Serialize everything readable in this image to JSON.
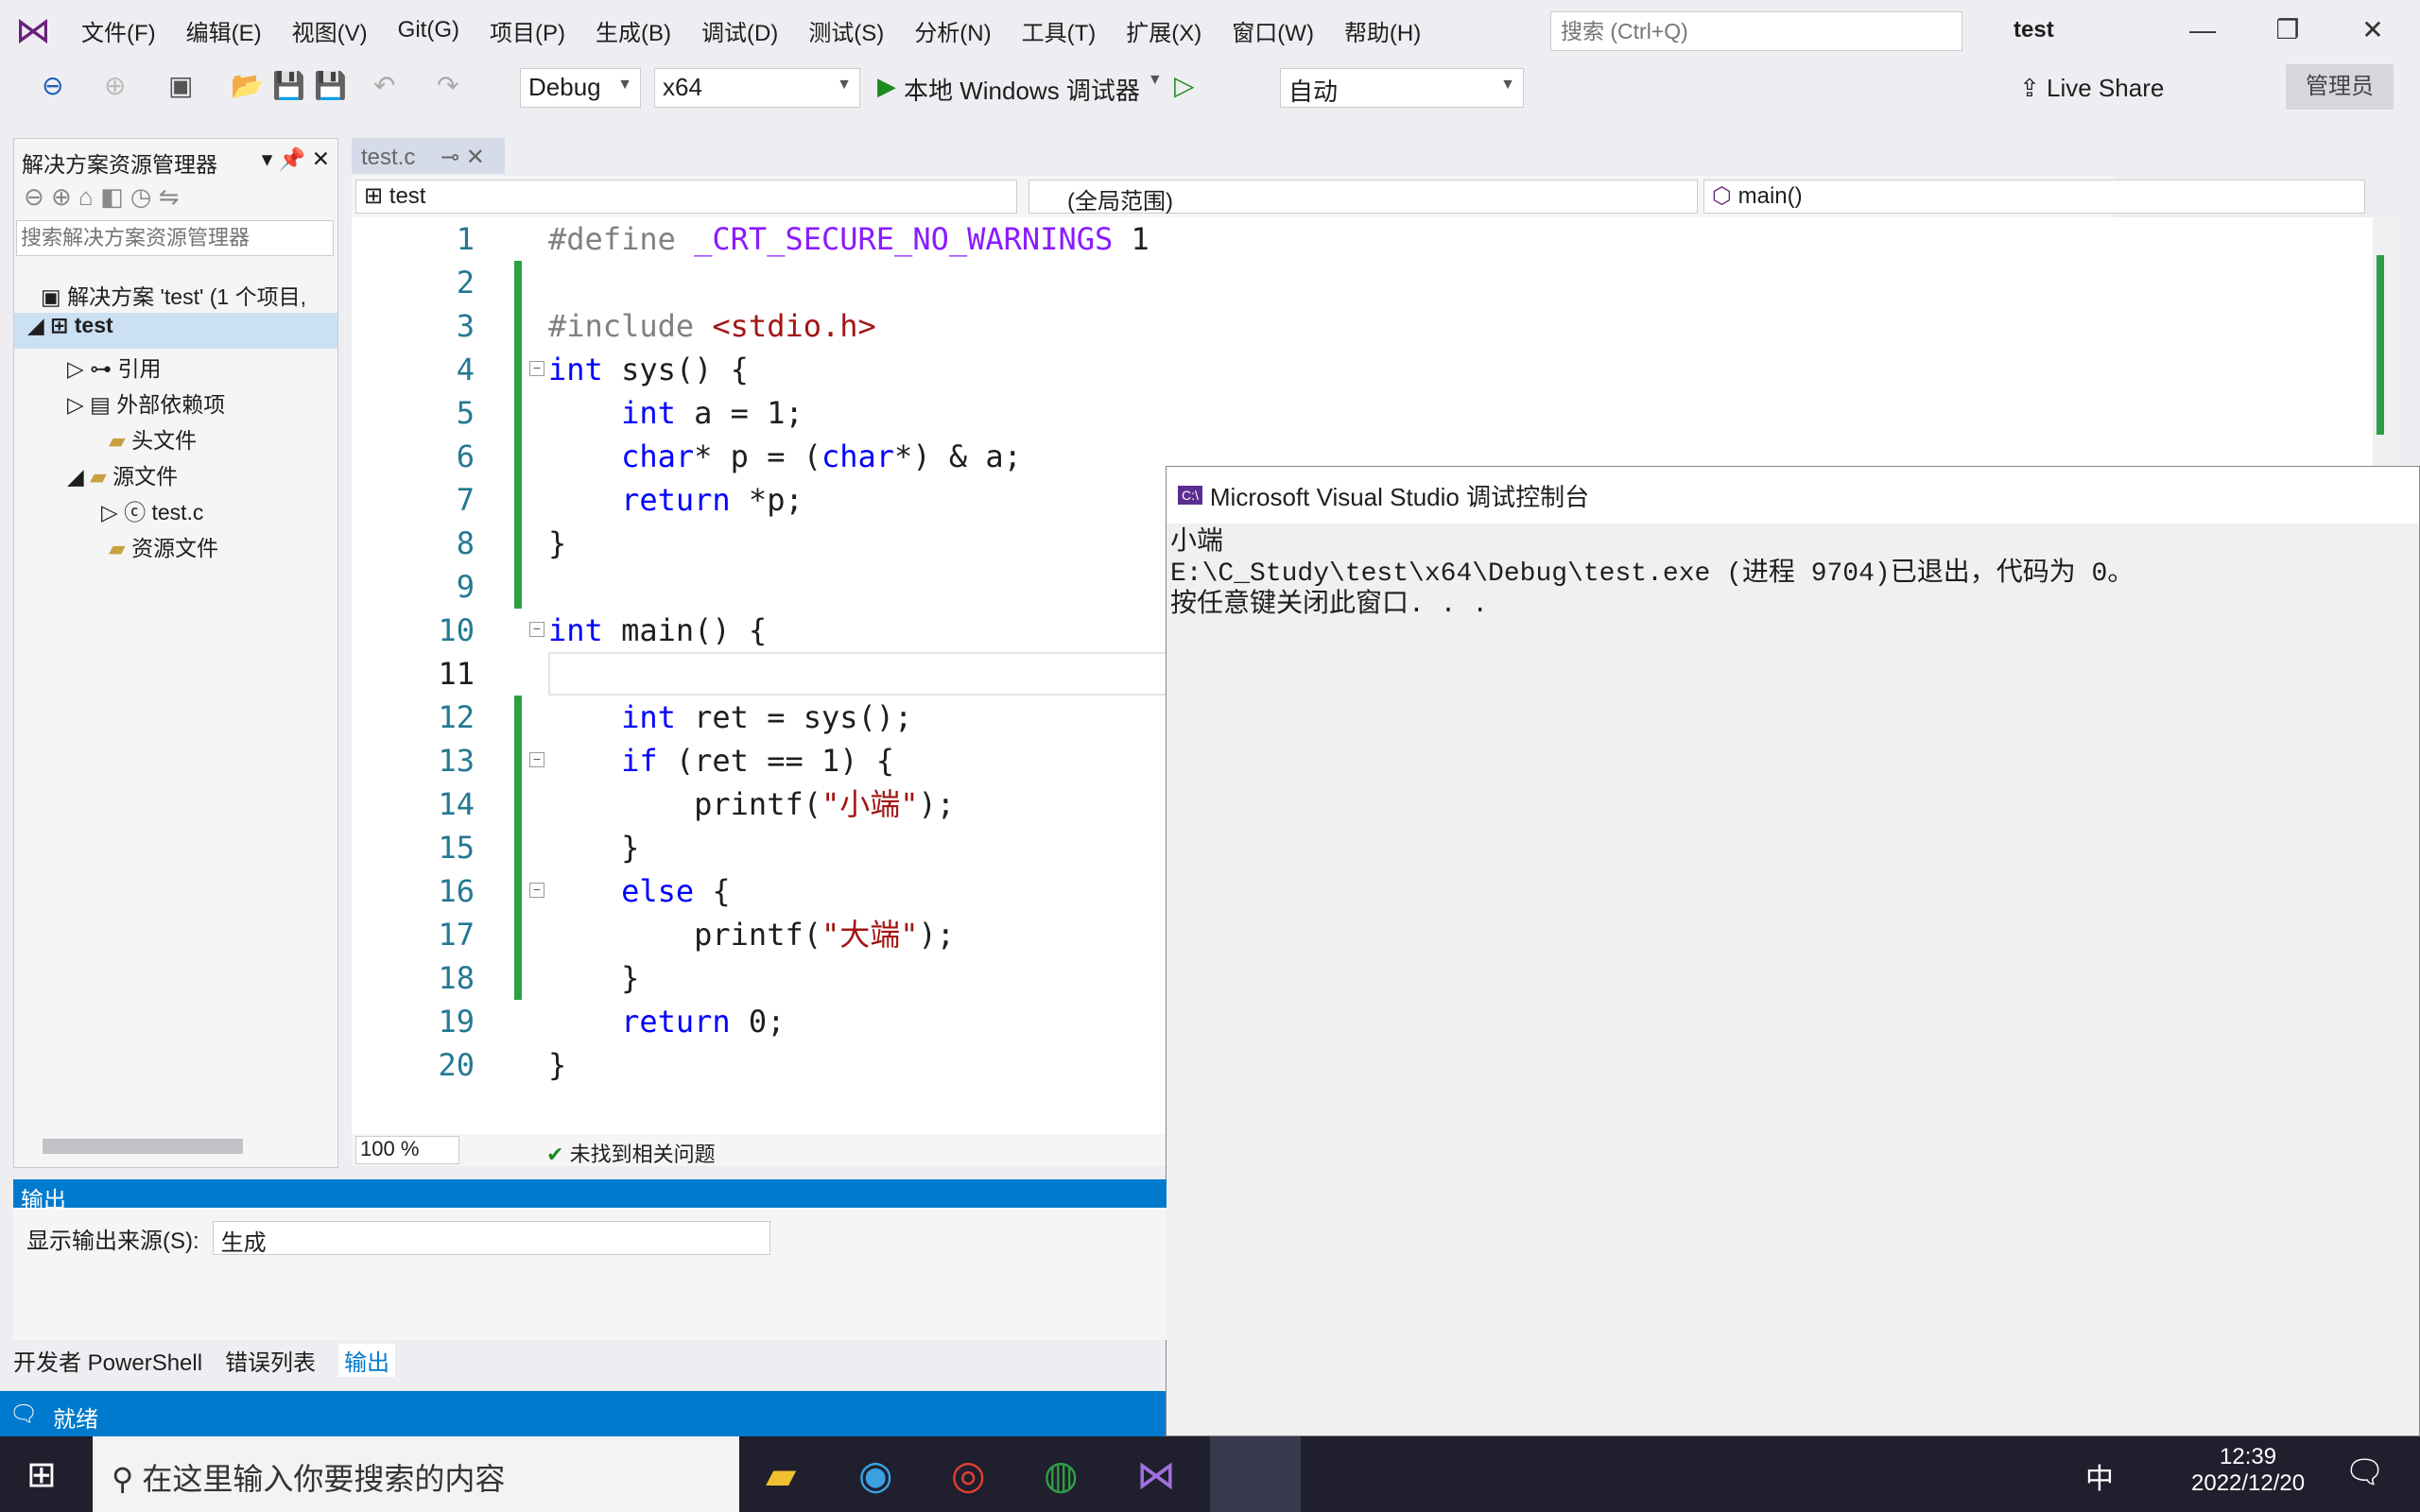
{
  "menu": [
    "文件(F)",
    "编辑(E)",
    "视图(V)",
    "Git(G)",
    "项目(P)",
    "生成(B)",
    "调试(D)",
    "测试(S)",
    "分析(N)",
    "工具(T)",
    "扩展(X)",
    "窗口(W)",
    "帮助(H)"
  ],
  "search_placeholder": "搜索 (Ctrl+Q)",
  "window_title": "test",
  "toolbar": {
    "config": "Debug",
    "platform": "x64",
    "run_label": "本地 Windows 调试器",
    "auto": "自动",
    "live_share": "Live Share",
    "admin": "管理员"
  },
  "solution_explorer": {
    "title": "解决方案资源管理器",
    "search_placeholder": "搜索解决方案资源管理器",
    "items": [
      {
        "label": "解决方案 'test' (1 个项目,"
      },
      {
        "label": "test"
      },
      {
        "label": "引用"
      },
      {
        "label": "外部依赖项"
      },
      {
        "label": "头文件"
      },
      {
        "label": "源文件"
      },
      {
        "label": "test.c"
      },
      {
        "label": "资源文件"
      }
    ]
  },
  "editor": {
    "tab": "test.c",
    "nav_project": "test",
    "nav_scope": "(全局范围)",
    "nav_member": "main()",
    "zoom": "100 %",
    "issues": "未找到相关问题",
    "lines": [
      [
        [
          "#define ",
          "pp"
        ],
        [
          "_CRT_SECURE_NO_WARNINGS",
          "mac"
        ],
        [
          " 1",
          "fn"
        ]
      ],
      [],
      [
        [
          "#include ",
          "pp"
        ],
        [
          "<stdio.h>",
          "str"
        ]
      ],
      [
        [
          "int",
          "kw"
        ],
        [
          " sys() {",
          "fn"
        ]
      ],
      [
        [
          "    int",
          "kw"
        ],
        [
          " a = 1;",
          "fn"
        ]
      ],
      [
        [
          "    char",
          "kw"
        ],
        [
          "* p = (",
          "fn"
        ],
        [
          "char",
          "kw"
        ],
        [
          "*) & a;",
          "fn"
        ]
      ],
      [
        [
          "    return",
          "kw"
        ],
        [
          " *p;",
          "fn"
        ]
      ],
      [
        [
          "}",
          "fn"
        ]
      ],
      [],
      [
        [
          "int",
          "kw"
        ],
        [
          " main() {",
          "fn"
        ]
      ],
      [],
      [
        [
          "    int",
          "kw"
        ],
        [
          " ret = sys();",
          "fn"
        ]
      ],
      [
        [
          "    if",
          "kw"
        ],
        [
          " (ret == 1) {",
          "fn"
        ]
      ],
      [
        [
          "        printf(",
          "fn"
        ],
        [
          "\"小端\"",
          "str"
        ],
        [
          ");",
          "fn"
        ]
      ],
      [
        [
          "    }",
          "fn"
        ]
      ],
      [
        [
          "    else",
          "kw"
        ],
        [
          " {",
          "fn"
        ]
      ],
      [
        [
          "        printf(",
          "fn"
        ],
        [
          "\"大端\"",
          "str"
        ],
        [
          ");",
          "fn"
        ]
      ],
      [
        [
          "    }",
          "fn"
        ]
      ],
      [
        [
          "    return",
          "kw"
        ],
        [
          " 0;",
          "fn"
        ]
      ],
      [
        [
          "}",
          "fn"
        ]
      ]
    ]
  },
  "console": {
    "title": "Microsoft Visual Studio 调试控制台",
    "lines": [
      "小端",
      "E:\\C_Study\\test\\x64\\Debug\\test.exe (进程 9704)已退出，代码为 0。",
      "按任意键关闭此窗口. . ."
    ]
  },
  "output": {
    "title": "输出",
    "source_label": "显示输出来源(S):",
    "source_value": "生成",
    "tabs": [
      "开发者 PowerShell",
      "错误列表",
      "输出"
    ]
  },
  "status": {
    "text": "就绪"
  },
  "taskbar": {
    "search_placeholder": "在这里输入你要搜索的内容",
    "time": "12:39",
    "date": "2022/12/20",
    "ime": "中"
  }
}
